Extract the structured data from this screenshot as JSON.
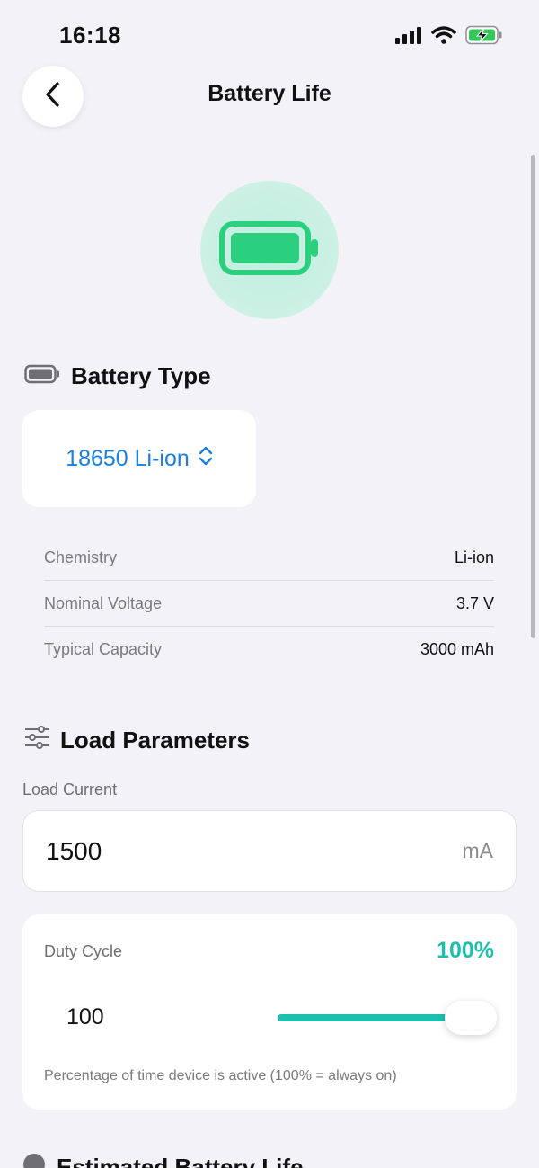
{
  "status_bar": {
    "time": "16:18",
    "icons": [
      "cellular-signal-icon",
      "wifi-icon",
      "battery-charging-icon"
    ]
  },
  "nav": {
    "back_icon": "chevron-left-icon",
    "title": "Battery Life"
  },
  "hero": {
    "icon": "battery-full-icon",
    "accent_color": "#2bd07f"
  },
  "battery_type": {
    "header_icon": "battery-icon",
    "title": "Battery Type",
    "picker_value": "18650 Li-ion",
    "picker_icon": "chevron-up-down-icon",
    "specs": [
      {
        "label": "Chemistry",
        "value": "Li-ion"
      },
      {
        "label": "Nominal Voltage",
        "value": "3.7 V"
      },
      {
        "label": "Typical Capacity",
        "value": "3000 mAh"
      }
    ]
  },
  "load_parameters": {
    "header_icon": "sliders-icon",
    "title": "Load Parameters",
    "load_current": {
      "label": "Load Current",
      "value": "1500",
      "unit": "mA"
    },
    "duty_cycle": {
      "label": "Duty Cycle",
      "percent_text": "100%",
      "value_text": "100",
      "value_fraction": 1.0,
      "hint": "Percentage of time device is active (100% = always on)",
      "accent_color": "#1dbfad"
    }
  },
  "estimated": {
    "header_icon": "info-icon",
    "title": "Estimated Battery Life"
  }
}
